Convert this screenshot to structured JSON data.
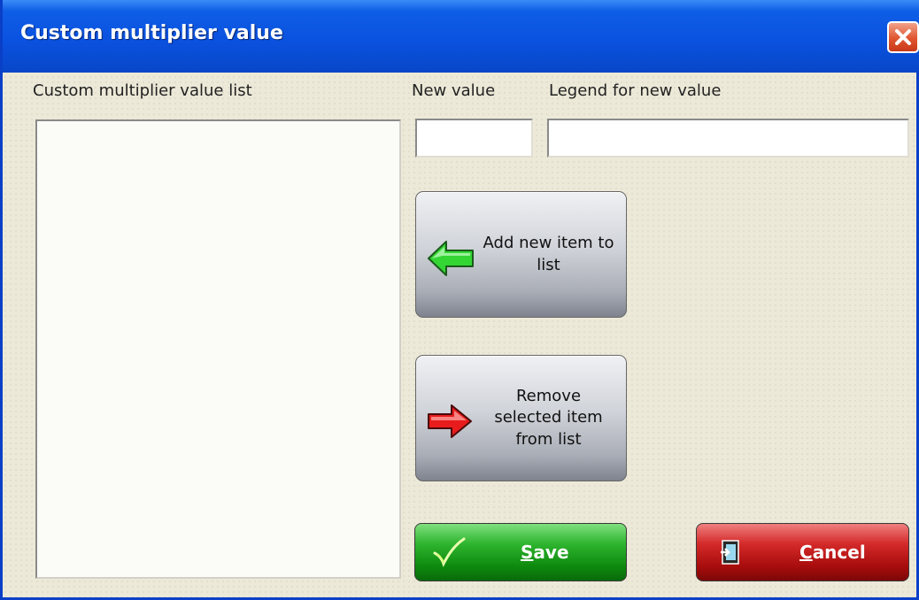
{
  "window": {
    "title": "Custom multiplier value"
  },
  "list": {
    "label": "Custom multiplier value list",
    "items": []
  },
  "new_value": {
    "label": "New value",
    "value": ""
  },
  "legend": {
    "label": "Legend for new value",
    "value": ""
  },
  "buttons": {
    "add": {
      "line1": "Add new item to",
      "line2": "list"
    },
    "remove": {
      "line1": "Remove",
      "line2": "selected item",
      "line3": "from list"
    },
    "save": {
      "hotkey": "S",
      "rest": "ave"
    },
    "cancel": {
      "hotkey": "C",
      "rest": "ancel"
    }
  },
  "colors": {
    "titlebar": "#0a52e0",
    "save": "#1a9e1a",
    "cancel": "#c81818",
    "add_arrow": "#33d633",
    "remove_arrow": "#e81c1c"
  },
  "icons": {
    "close": "close-icon",
    "add": "arrow-left-icon",
    "remove": "arrow-right-icon",
    "save": "checkmark-icon",
    "cancel": "exit-door-icon"
  }
}
